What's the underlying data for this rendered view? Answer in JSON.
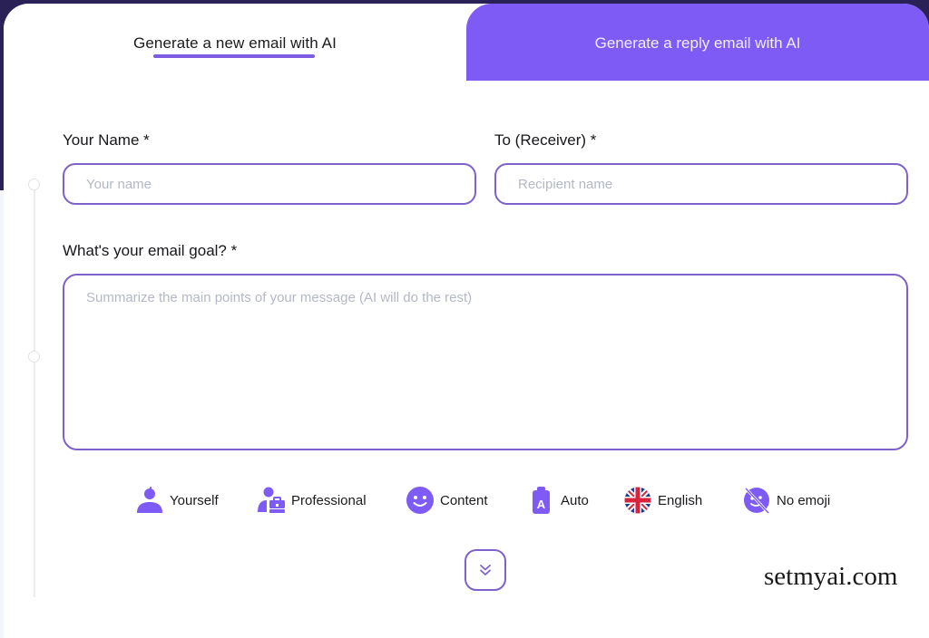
{
  "tabs": {
    "active_label": "Generate a new email with AI",
    "inactive_label": "Generate a reply email with AI"
  },
  "form": {
    "name_label": "Your Name *",
    "name_placeholder": "Your name",
    "name_value": "",
    "receiver_label": "To (Receiver) *",
    "receiver_placeholder": "Recipient name",
    "receiver_value": "",
    "goal_label": "What's your email goal? *",
    "goal_placeholder": "Summarize the main points of your message (AI will do the rest)",
    "goal_value": ""
  },
  "options": [
    {
      "label": "Yourself",
      "icon": "person-icon"
    },
    {
      "label": "Professional",
      "icon": "professional-briefcase-icon"
    },
    {
      "label": "Content",
      "icon": "smiley-face-icon"
    },
    {
      "label": "Auto",
      "icon": "auto-length-clipboard-icon"
    },
    {
      "label": "English",
      "icon": "uk-flag-icon"
    },
    {
      "label": "No emoji",
      "icon": "no-emoji-icon"
    }
  ],
  "expand_button": {
    "icon": "double-chevron-down-icon"
  },
  "watermark": "setmyai.com",
  "colors": {
    "accent": "#7e5bf5",
    "input_border": "#7d62cc",
    "dark_bg": "#2a2157"
  }
}
